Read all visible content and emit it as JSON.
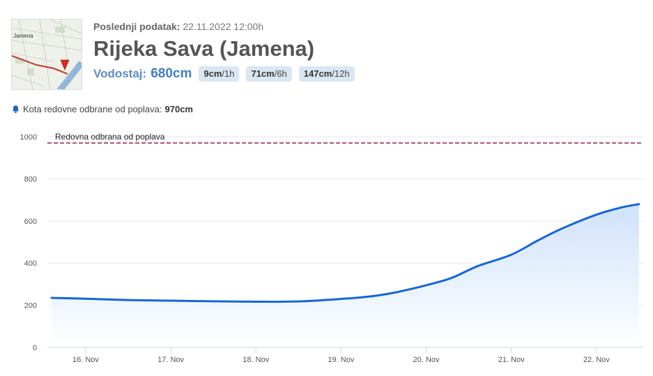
{
  "header": {
    "last_data_label": "Poslednji podatak:",
    "last_data_value": "22.11.2022 12:00h",
    "title": "Rijeka Sava (Jamena)",
    "level_label": "Vodostaj:",
    "level_value": "680cm",
    "changes": [
      {
        "amount": "9cm",
        "period": "/1h"
      },
      {
        "amount": "71cm",
        "period": "/6h"
      },
      {
        "amount": "147cm",
        "period": "/12h"
      }
    ],
    "map_labels": [
      "Jamena"
    ]
  },
  "defense": {
    "icon": "bell-icon",
    "label": "Kota redovne odbrane od poplava:",
    "value": "970cm"
  },
  "colors": {
    "line": "#1565d8",
    "area_top": "#cfe2fa",
    "threshold": "#9b1c4f",
    "grid": "#e6e6e6"
  },
  "chart_data": {
    "type": "area",
    "ylim": [
      0,
      1000
    ],
    "yticks": [
      0,
      200,
      400,
      600,
      800,
      1000
    ],
    "xlim": [
      15.55,
      22.55
    ],
    "xticks": [
      {
        "value": 16,
        "label": "16. Nov"
      },
      {
        "value": 17,
        "label": "17. Nov"
      },
      {
        "value": 18,
        "label": "18. Nov"
      },
      {
        "value": 19,
        "label": "19. Nov"
      },
      {
        "value": 20,
        "label": "20. Nov"
      },
      {
        "value": 21,
        "label": "21. Nov"
      },
      {
        "value": 22,
        "label": "22. Nov"
      }
    ],
    "x": [
      15.6,
      16.0,
      16.5,
      17.0,
      17.5,
      18.0,
      18.3,
      18.6,
      19.0,
      19.3,
      19.6,
      20.0,
      20.3,
      20.6,
      21.0,
      21.3,
      21.6,
      22.0,
      22.3,
      22.5
    ],
    "values": [
      235,
      231,
      225,
      222,
      219,
      217,
      217,
      220,
      230,
      240,
      258,
      295,
      330,
      385,
      440,
      505,
      565,
      630,
      665,
      680
    ],
    "plot_lines": [
      {
        "value": 970,
        "label": "Redovna odbrana od poplava"
      }
    ]
  }
}
